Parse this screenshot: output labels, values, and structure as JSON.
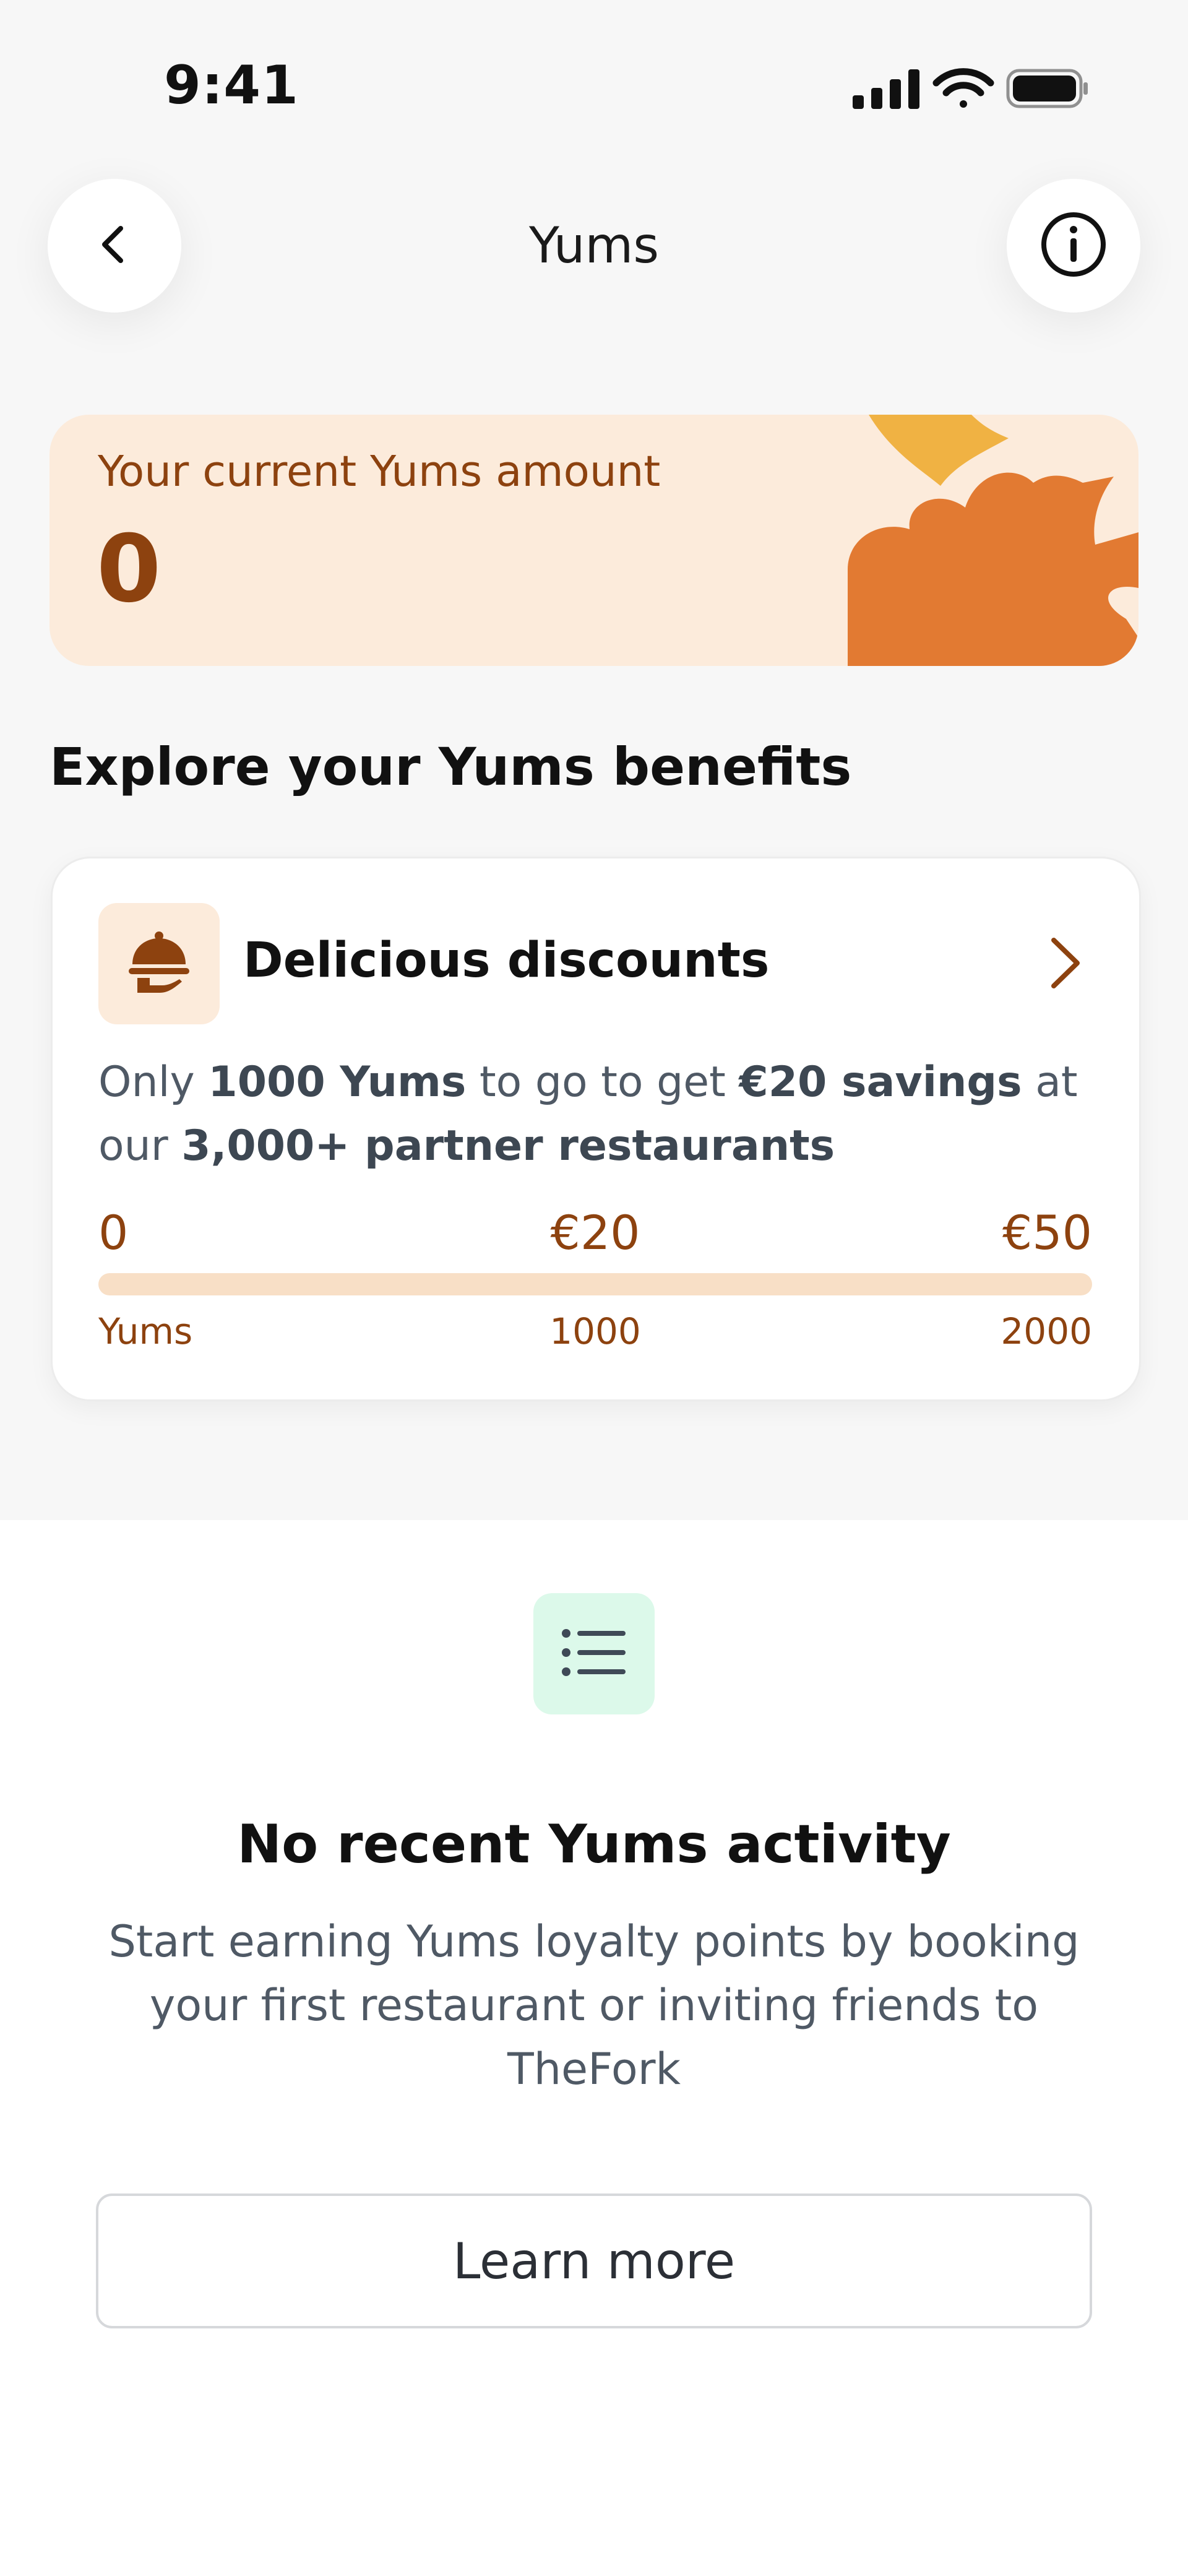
{
  "status_bar": {
    "time": "9:41",
    "icons": [
      "signal-icon",
      "wifi-icon",
      "battery-icon"
    ]
  },
  "header": {
    "title": "Yums",
    "back_icon": "chevron-left-icon",
    "info_icon": "info-icon"
  },
  "amount_card": {
    "label": "Your current Yums amount",
    "value": "0"
  },
  "benefits": {
    "section_title": "Explore your Yums benefits",
    "card": {
      "icon": "cloche-icon",
      "title": "Delicious discounts",
      "desc_parts": [
        "Only ",
        "1000 Yums",
        " to go to get ",
        "€20 savings",
        " at our ",
        "3,000+ partner restaurants"
      ],
      "milestones": [
        "0",
        "€20",
        "€50"
      ],
      "sublabels": [
        "Yums",
        "1000",
        "2000"
      ],
      "progress": 0
    }
  },
  "activity": {
    "icon": "list-icon",
    "title": "No recent Yums activity",
    "description": "Start earning Yums loyalty points by booking your first restaurant or inviting friends to TheFork",
    "button_label": "Learn more"
  },
  "colors": {
    "accent_brown": "#8d420f",
    "peach_bg": "#fcebdb",
    "orange": "#e27a32",
    "yellow": "#f0b243",
    "mint": "#dcf9ea"
  }
}
